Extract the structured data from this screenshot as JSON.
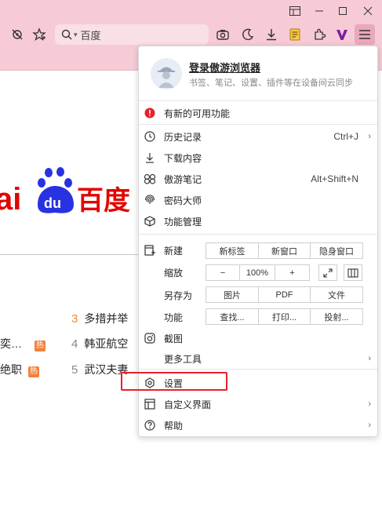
{
  "toolbar": {
    "search_placeholder": "百度"
  },
  "page": {
    "hot_list": [
      {
        "num": "3",
        "text": "多措并举",
        "top": true
      },
      {
        "num": "4",
        "text": "韩亚航空",
        "top": false
      },
      {
        "num": "5",
        "text": "武汉夫妻",
        "top": false
      }
    ],
    "left_fragments": [
      {
        "text": "奕…",
        "badge": "热"
      },
      {
        "text": "绝职",
        "badge": "热"
      }
    ]
  },
  "menu": {
    "profile_title": "登录傲游浏览器",
    "profile_sub": "书签、笔记、设置、插件等在设备间云同步",
    "new_features": "有新的可用功能",
    "history": "历史记录",
    "history_shortcut": "Ctrl+J",
    "downloads": "下载内容",
    "notes": "傲游笔记",
    "notes_shortcut": "Alt+Shift+N",
    "passwords": "密码大师",
    "extensions": "功能管理",
    "new_label": "新建",
    "new_tab": "新标签",
    "new_window": "新窗口",
    "incognito": "隐身窗口",
    "zoom_label": "缩放",
    "zoom_minus": "−",
    "zoom_value": "100%",
    "zoom_plus": "+",
    "save_as_label": "另存为",
    "save_image": "图片",
    "save_pdf": "PDF",
    "save_file": "文件",
    "function_label": "功能",
    "find": "查找...",
    "print": "打印...",
    "cast": "投射...",
    "screenshot": "截图",
    "more_tools": "更多工具",
    "settings": "设置",
    "customize": "自定义界面",
    "help": "帮助"
  },
  "colors": {
    "toolbar_bg": "#f6cbd5",
    "accent_red": "#e8202a",
    "baidu_red": "#e10601",
    "baidu_blue": "#2932e1",
    "hot_orange": "#f2813a"
  }
}
